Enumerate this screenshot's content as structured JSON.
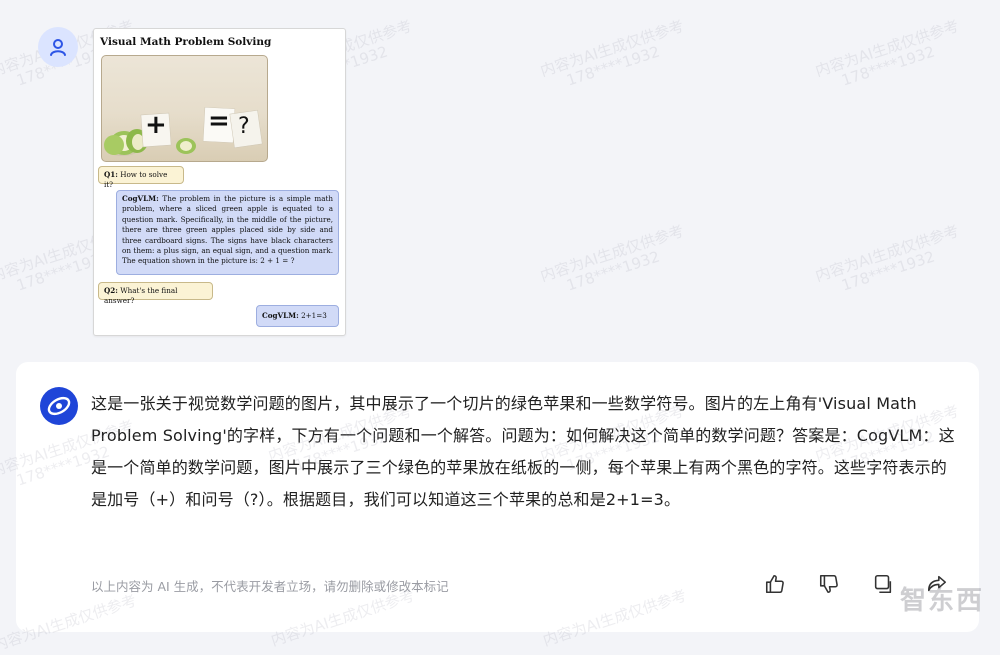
{
  "image_card": {
    "title": "Visual Math Problem Solving",
    "photo_symbols": {
      "plus": "+",
      "equals": "=",
      "question": "?"
    },
    "q1_label": "Q1:",
    "q1_text": " How to solve it?",
    "a1_label": "CogVLM:",
    "a1_text": " The problem in the picture is a simple math problem, where a sliced green apple is equated to a question mark. Specifically, in the middle of the picture, there are three green apples placed side by side and three cardboard signs. The signs have black characters on them: a plus sign, an equal sign, and a question mark. The equation shown in the picture is: 2 + 1 = ?",
    "q2_label": "Q2:",
    "q2_text": " What's the final answer?",
    "a2_label": "CogVLM:",
    "a2_text": " 2+1=3"
  },
  "response": {
    "text": "这是一张关于视觉数学问题的图片，其中展示了一个切片的绿色苹果和一些数学符号。图片的左上角有'Visual Math Problem Solving'的字样，下方有一个问题和一个解答。问题为：如何解决这个简单的数学问题？答案是：CogVLM：这是一个简单的数学问题，图片中展示了三个绿色的苹果放在纸板的一侧，每个苹果上有两个黑色的字符。这些字符表示的是加号（+）和问号（?）。根据题目，我们可以知道这三个苹果的总和是2+1=3。",
    "disclaimer": "以上内容为 AI 生成，不代表开发者立场，请勿删除或修改本标记"
  },
  "watermark": {
    "line1": "内容为AI生成仅供参考",
    "line2": "178****1932"
  },
  "brand": "智东西",
  "icons": {
    "user": "user-icon",
    "bot": "bot-logo-icon",
    "like": "thumbs-up-icon",
    "dislike": "thumbs-down-icon",
    "copy": "copy-icon",
    "share": "share-icon"
  },
  "colors": {
    "accent": "#1f45d8",
    "panel": "#ffffff",
    "background": "#f3f4f8"
  }
}
